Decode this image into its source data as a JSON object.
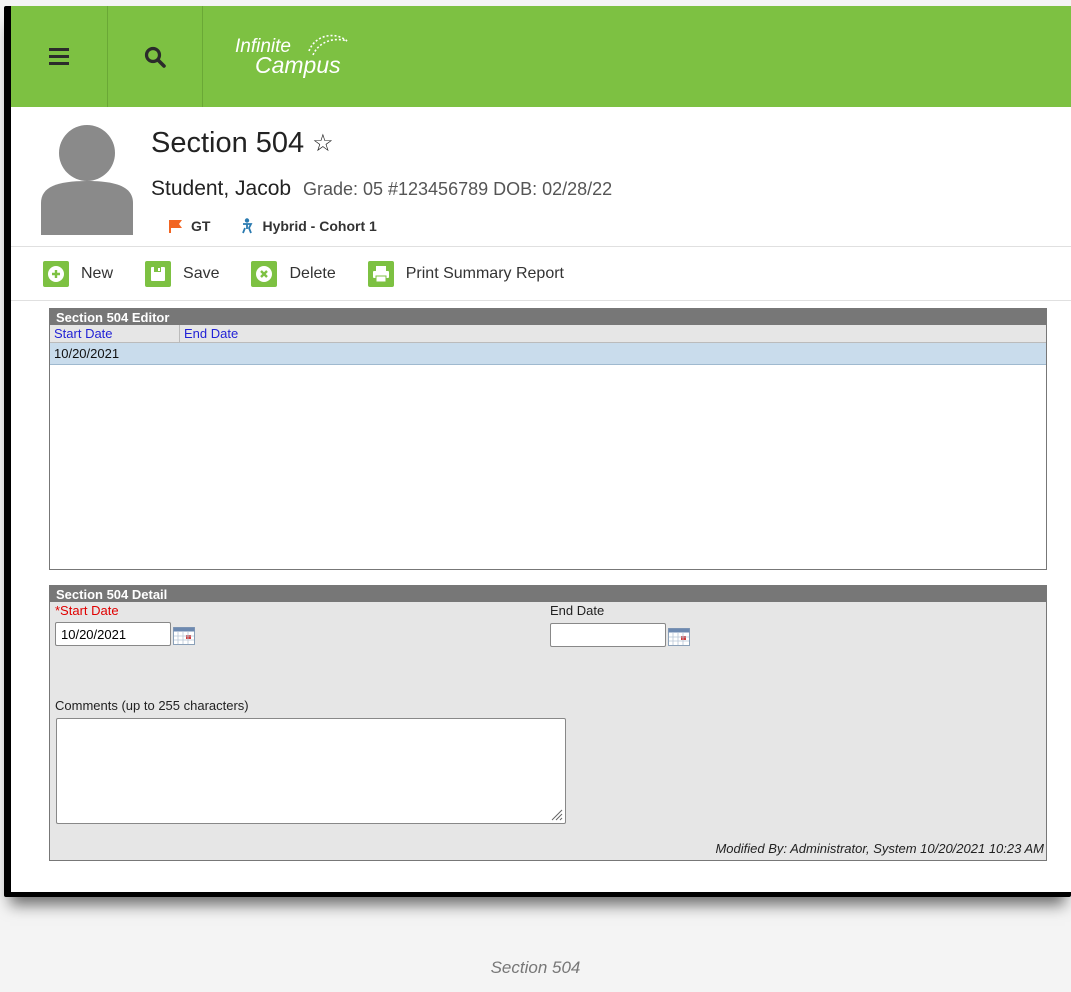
{
  "app": {
    "logo_line1": "Infinite",
    "logo_line2": "Campus"
  },
  "header": {
    "title": "Section 504",
    "student_name": "Student, Jacob",
    "student_meta": "Grade: 05 #123456789 DOB: 02/28/22",
    "flags": [
      {
        "label": "GT",
        "icon": "flag-icon",
        "color": "#f26522"
      },
      {
        "label": "Hybrid - Cohort 1",
        "icon": "person-icon",
        "color": "#2a7ab0"
      }
    ]
  },
  "toolbar": {
    "new_label": "New",
    "save_label": "Save",
    "delete_label": "Delete",
    "print_label": "Print Summary Report"
  },
  "editor": {
    "title": "Section 504 Editor",
    "columns": [
      "Start Date",
      "End Date"
    ],
    "rows": [
      {
        "start_date": "10/20/2021",
        "end_date": ""
      }
    ]
  },
  "detail": {
    "title": "Section 504 Detail",
    "start_label": "*Start Date",
    "start_value": "10/20/2021",
    "end_label": "End Date",
    "end_value": "",
    "comments_label": "Comments (up to 255 characters)",
    "comments_value": "",
    "modified": "Modified By: Administrator, System 10/20/2021 10:23 AM"
  },
  "caption": "Section 504",
  "colors": {
    "accent": "#7dc142",
    "required": "#e00000",
    "link": "#2323d6",
    "selected_row": "#c9dcec"
  }
}
